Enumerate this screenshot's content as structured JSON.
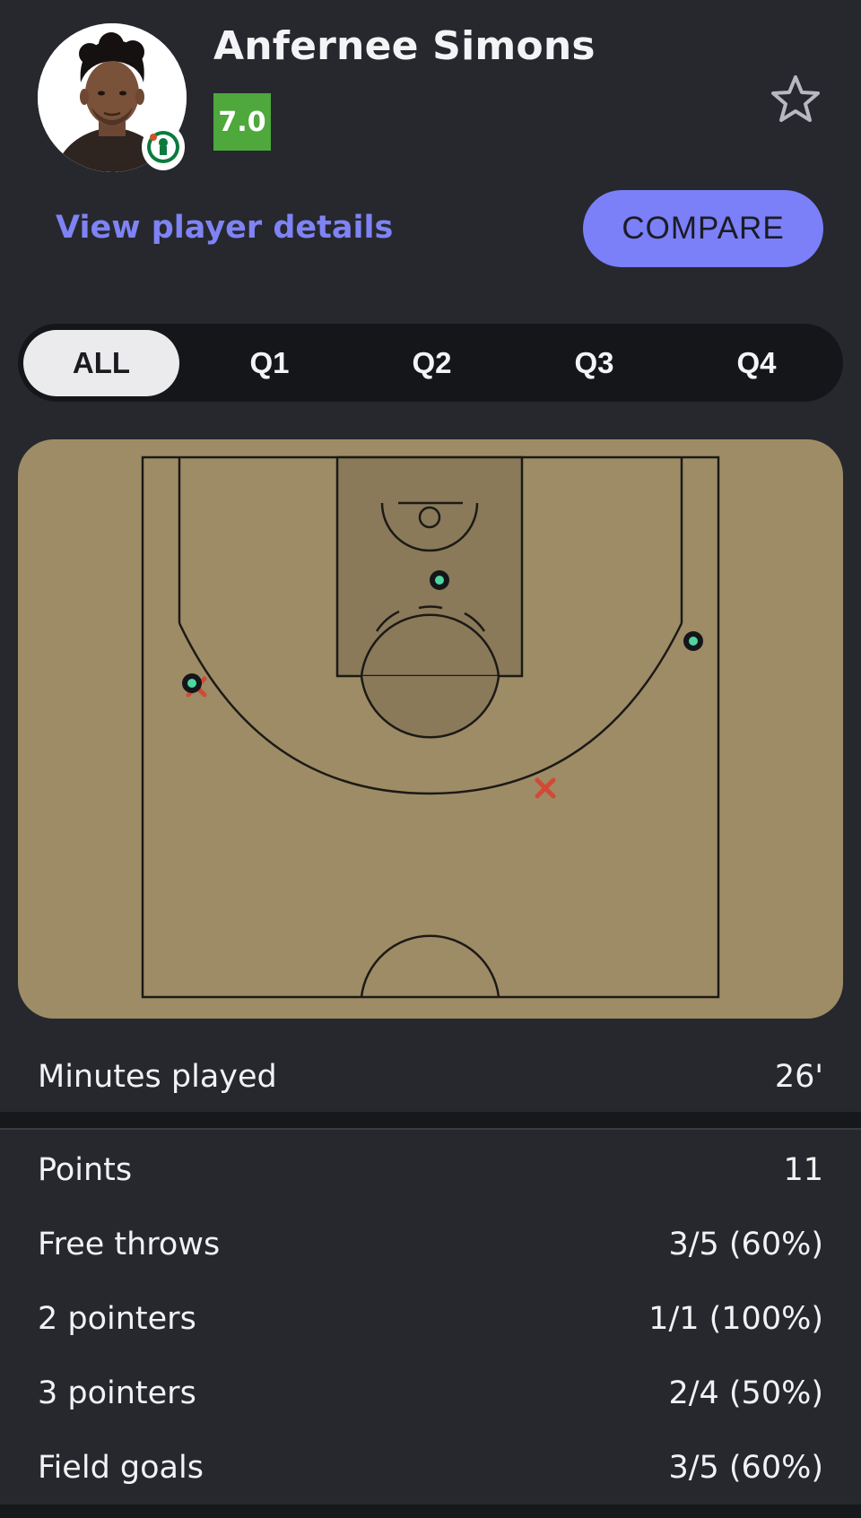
{
  "player": {
    "name": "Anfernee Simons",
    "rating": "7.0"
  },
  "actions": {
    "details_link": "View player details",
    "compare_label": "COMPARE"
  },
  "period_tabs": [
    {
      "label": "ALL",
      "active": true
    },
    {
      "label": "Q1",
      "active": false
    },
    {
      "label": "Q2",
      "active": false
    },
    {
      "label": "Q3",
      "active": false
    },
    {
      "label": "Q4",
      "active": false
    }
  ],
  "shot_chart": {
    "made_shots": 3,
    "missed_shots": 2,
    "colors": {
      "court": "#9e8c66",
      "paint": "#8a7a5a",
      "made": "#4fd6a0",
      "missed": "#d24a35"
    }
  },
  "minutes": {
    "label": "Minutes played",
    "value": "26'"
  },
  "stats": [
    {
      "label": "Points",
      "value": "11"
    },
    {
      "label": "Free throws",
      "value": "3/5 (60%)"
    },
    {
      "label": "2 pointers",
      "value": "1/1 (100%)"
    },
    {
      "label": "3 pointers",
      "value": "2/4 (50%)"
    },
    {
      "label": "Field goals",
      "value": "3/5 (60%)"
    }
  ],
  "icons": {
    "favorite": "star-outline-icon",
    "team": "team-logo-icon"
  },
  "colors": {
    "background": "#26282e",
    "accent": "#7b7ff8",
    "rating_good": "#4ea83c"
  }
}
